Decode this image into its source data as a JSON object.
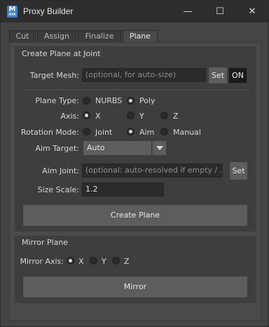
{
  "window": {
    "title": "Proxy Builder",
    "icon": "maya-app-icon",
    "icon_letter": "M",
    "icon_sub": "AYA",
    "minimize_glyph": "—",
    "maximize_glyph": "☐",
    "close_glyph": "✕"
  },
  "tabs": [
    {
      "label": "Cut",
      "active": false
    },
    {
      "label": "Assign",
      "active": false
    },
    {
      "label": "Finalize",
      "active": false
    },
    {
      "label": "Plane",
      "active": true
    }
  ],
  "create_plane": {
    "title": "Create Plane at Joint",
    "target_mesh": {
      "label": "Target Mesh:",
      "placeholder": "(optional, for auto-size)",
      "set_label": "Set",
      "on_label": "ON"
    },
    "plane_type": {
      "label": "Plane Type:",
      "options": [
        "NURBS",
        "Poly"
      ],
      "selected": "Poly"
    },
    "axis": {
      "label": "Axis:",
      "options": [
        "X",
        "Y",
        "Z"
      ],
      "selected": "X"
    },
    "rotation_mode": {
      "label": "Rotation Mode:",
      "options": [
        "Joint",
        "Aim",
        "Manual"
      ],
      "selected": "Aim"
    },
    "aim_target": {
      "label": "Aim Target:",
      "value": "Auto"
    },
    "aim_joint": {
      "label": "Aim Joint:",
      "placeholder": "(optional: auto-resolved if empty / ...",
      "set_label": "Set"
    },
    "size_scale": {
      "label": "Size Scale:",
      "value": "1.2"
    },
    "create_button": "Create Plane"
  },
  "mirror_plane": {
    "title": "Mirror Plane",
    "mirror_axis": {
      "label": "Mirror Axis:",
      "options": [
        "X",
        "Y",
        "Z"
      ],
      "selected": "X"
    },
    "mirror_button": "Mirror"
  }
}
